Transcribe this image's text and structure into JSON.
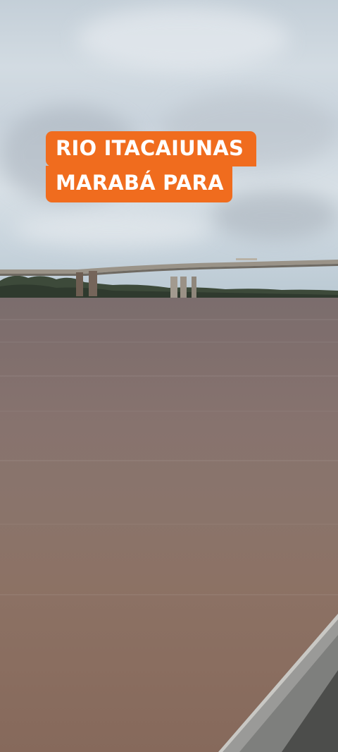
{
  "caption": {
    "line1": "RIO ITACAIUNAS",
    "line2": "MARABÁ PARA"
  },
  "colors": {
    "caption_bg": "#f06c1e",
    "caption_text": "#ffffff",
    "river": "#8a7066",
    "sky": "#c9d3dc"
  }
}
